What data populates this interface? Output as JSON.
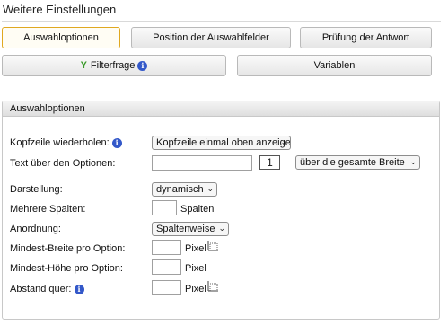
{
  "title": "Weitere Einstellungen",
  "tabs": {
    "auswahloptionen": "Auswahloptionen",
    "position": "Position der Auswahlfelder",
    "pruefung": "Prüfung der Antwort",
    "filterfrage": "Filterfrage",
    "variablen": "Variablen"
  },
  "panel": {
    "heading": "Auswahloptionen",
    "kopfzeile": {
      "label": "Kopfzeile wiederholen:",
      "value": "Kopfzeile einmal oben anzeigen"
    },
    "text_ueber": {
      "label": "Text über den Optionen:",
      "value": "",
      "number": "1",
      "width_option": "über die gesamte Breite"
    },
    "darstellung": {
      "label": "Darstellung:",
      "value": "dynamisch"
    },
    "mehrere_spalten": {
      "label": "Mehrere Spalten:",
      "value": "",
      "unit": "Spalten"
    },
    "anordnung": {
      "label": "Anordnung:",
      "value": "Spaltenweise"
    },
    "mindest_breite": {
      "label": "Mindest-Breite pro Option:",
      "value": "",
      "unit": "Pixel"
    },
    "mindest_hoehe": {
      "label": "Mindest-Höhe pro Option:",
      "value": "",
      "unit": "Pixel"
    },
    "abstand_quer": {
      "label": "Abstand quer:",
      "value": "",
      "unit": "Pixel"
    }
  },
  "icons": {
    "info": "info-icon",
    "filter": "filter-icon",
    "ruler": "ruler-icon"
  }
}
